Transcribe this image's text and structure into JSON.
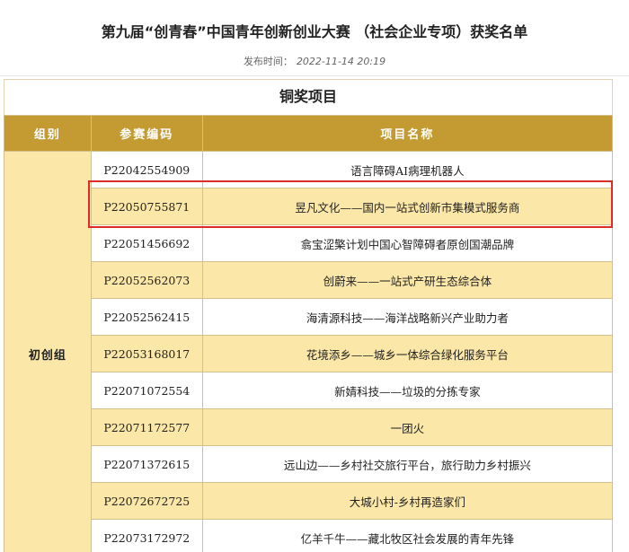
{
  "article": {
    "title": "第九届“创青春”中国青年创新创业大赛 （社会企业专项）获奖名单",
    "publish_label": "发布时间：",
    "publish_date": "2022-11-14 20:19"
  },
  "table": {
    "caption": "铜奖项目",
    "headers": {
      "group": "组别",
      "code": "参赛编码",
      "name": "项目名称"
    },
    "group_label": "初创组",
    "rows": [
      {
        "code": "P22042554909",
        "name": "语言障碍AI病理机器人"
      },
      {
        "code": "P22050755871",
        "name": "昱凡文化——国内一站式创新市集模式服务商"
      },
      {
        "code": "P22051456692",
        "name": "翕宝涩檠计划中国心智障碍者原创国潮品牌"
      },
      {
        "code": "P22052562073",
        "name": "创蔚来——一站式产研生态综合体"
      },
      {
        "code": "P22052562415",
        "name": "海清源科技——海洋战略新兴产业助力者"
      },
      {
        "code": "P22053168017",
        "name": "花境添乡——城乡一体综合绿化服务平台"
      },
      {
        "code": "P22071072554",
        "name": "新婧科技——垃圾的分拣专家"
      },
      {
        "code": "P22071172577",
        "name": "一团火"
      },
      {
        "code": "P22071372615",
        "name": "远山边——乡村社交旅行平台，旅行助力乡村振兴"
      },
      {
        "code": "P22072672725",
        "name": "大城小村-乡村再造家们"
      },
      {
        "code": "P22073172972",
        "name": "亿羊千牛——藏北牧区社会发展的青年先锋"
      }
    ]
  },
  "colors": {
    "header_bg": "#c49b32",
    "row_shade": "#fbe7a7",
    "highlight_border": "#e02a2a"
  }
}
